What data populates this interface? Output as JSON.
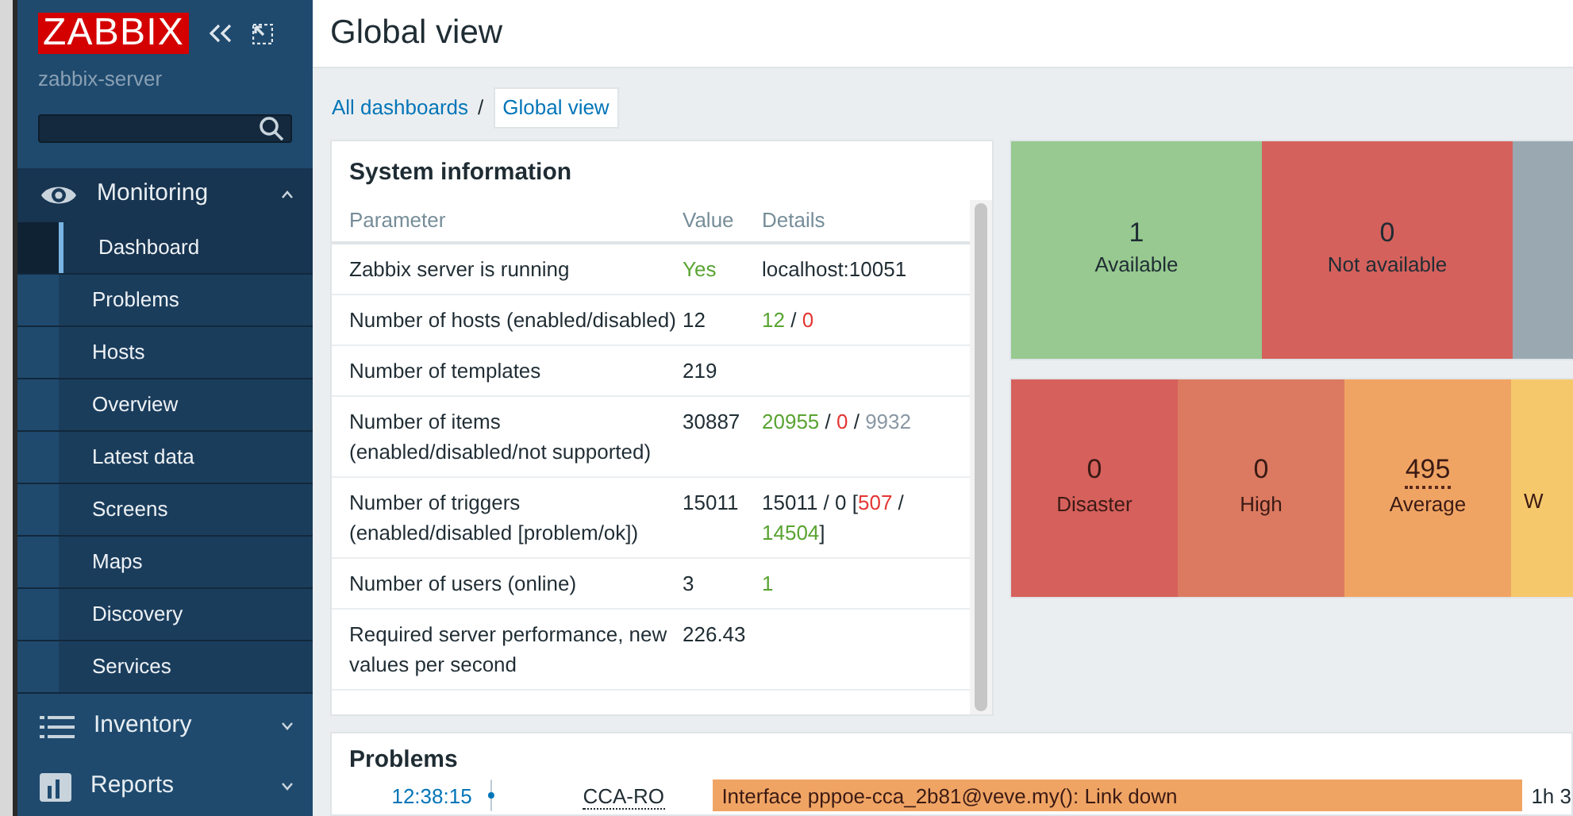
{
  "sidebar": {
    "logo": "ZABBIX",
    "server": "zabbix-server",
    "sections": [
      {
        "label": "Monitoring",
        "expanded": true,
        "items": [
          {
            "label": "Dashboard",
            "selected": true
          },
          {
            "label": "Problems",
            "selected": false
          },
          {
            "label": "Hosts",
            "selected": false
          },
          {
            "label": "Overview",
            "selected": false
          },
          {
            "label": "Latest data",
            "selected": false
          },
          {
            "label": "Screens",
            "selected": false
          },
          {
            "label": "Maps",
            "selected": false
          },
          {
            "label": "Discovery",
            "selected": false
          },
          {
            "label": "Services",
            "selected": false
          }
        ]
      },
      {
        "label": "Inventory",
        "expanded": false
      },
      {
        "label": "Reports",
        "expanded": false
      }
    ]
  },
  "page_title": "Global view",
  "breadcrumb": [
    {
      "label": "All dashboards",
      "selected": false
    },
    {
      "label": "Global view",
      "selected": true
    }
  ],
  "breadcrumb_separator": "/",
  "system_information": {
    "title": "System information",
    "columns": [
      "Parameter",
      "Value",
      "Details"
    ],
    "rows": [
      {
        "parameter": "Zabbix server is running",
        "value": "Yes",
        "value_ok": true,
        "details": [
          {
            "text": "localhost:10051",
            "kind": "plain"
          }
        ]
      },
      {
        "parameter": "Number of hosts (enabled/disabled)",
        "value": "12",
        "value_ok": false,
        "details": [
          {
            "text": "12",
            "kind": "ok"
          },
          {
            "text": " / ",
            "kind": "plain"
          },
          {
            "text": "0",
            "kind": "problem"
          }
        ]
      },
      {
        "parameter": "Number of templates",
        "value": "219",
        "value_ok": false,
        "details": []
      },
      {
        "parameter": "Number of items (enabled/disabled/not supported)",
        "value": "30887",
        "value_ok": false,
        "details": [
          {
            "text": "20955",
            "kind": "ok"
          },
          {
            "text": " / ",
            "kind": "plain"
          },
          {
            "text": "0",
            "kind": "problem"
          },
          {
            "text": " / ",
            "kind": "plain"
          },
          {
            "text": "9932",
            "kind": "muted"
          }
        ]
      },
      {
        "parameter": "Number of triggers (enabled/disabled [problem/ok])",
        "value": "15011",
        "value_ok": false,
        "details": [
          {
            "text": "15011 / 0 [",
            "kind": "plain"
          },
          {
            "text": "507",
            "kind": "problem"
          },
          {
            "text": " / ",
            "kind": "plain"
          },
          {
            "text": "14504",
            "kind": "ok"
          },
          {
            "text": "]",
            "kind": "plain"
          }
        ]
      },
      {
        "parameter": "Number of users (online)",
        "value": "3",
        "value_ok": false,
        "details": [
          {
            "text": "1",
            "kind": "ok"
          }
        ]
      },
      {
        "parameter": "Required server performance, new values per second",
        "value": "226.43",
        "value_ok": false,
        "details": []
      }
    ]
  },
  "host_availability": [
    {
      "count": "1",
      "label": "Available",
      "color": "#97c990"
    },
    {
      "count": "0",
      "label": "Not available",
      "color": "#d5615c"
    },
    {
      "color": "#9aa9b1"
    }
  ],
  "problem_severity": [
    {
      "count": "0",
      "label": "Disaster",
      "color": "#d6605c",
      "underlined": false
    },
    {
      "count": "0",
      "label": "High",
      "color": "#db7a61",
      "underlined": false
    },
    {
      "count": "495",
      "label": "Average",
      "color": "#f0a464",
      "underlined": true
    },
    {
      "label": "W",
      "color": "#f6c86c",
      "underlined": false
    }
  ],
  "problems": {
    "title": "Problems",
    "rows": [
      {
        "time": "12:38:15",
        "host": "CCA-RO",
        "problem": "Interface pppoe-cca_2b81@veve.my(): Link down",
        "color": "#f0a464",
        "duration": "1h 3"
      }
    ]
  }
}
